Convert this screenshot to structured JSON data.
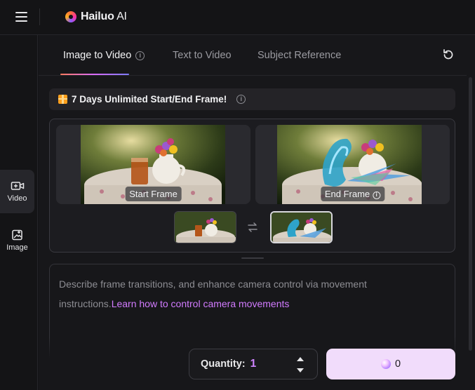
{
  "app": {
    "brand_main": "Hailuo",
    "brand_ai": " AI"
  },
  "sidebar": {
    "items": [
      {
        "label": "Video",
        "icon": "video-plus-icon",
        "active": true
      },
      {
        "label": "Image",
        "icon": "image-plus-icon",
        "active": false
      }
    ]
  },
  "tabs": [
    {
      "label": "Image to Video",
      "active": true,
      "has_info": true
    },
    {
      "label": "Text to Video",
      "active": false
    },
    {
      "label": "Subject Reference",
      "active": false
    }
  ],
  "promo": {
    "text": "7 Days Unlimited Start/End Frame!",
    "icon": "gift-icon"
  },
  "frames": {
    "start_label": "Start Frame",
    "end_label": "End Frame"
  },
  "prompt": {
    "placeholder": "Describe frame transitions, and enhance camera control via movement instructions.",
    "link": "Learn how to control camera movements"
  },
  "quantity": {
    "label": "Quantity:",
    "value": "1"
  },
  "generate": {
    "credits": "0",
    "icon": "gem-icon"
  },
  "colors": {
    "accent": "#cf84ff",
    "generate_bg": "#f1dcfb",
    "background": "#17171a"
  }
}
